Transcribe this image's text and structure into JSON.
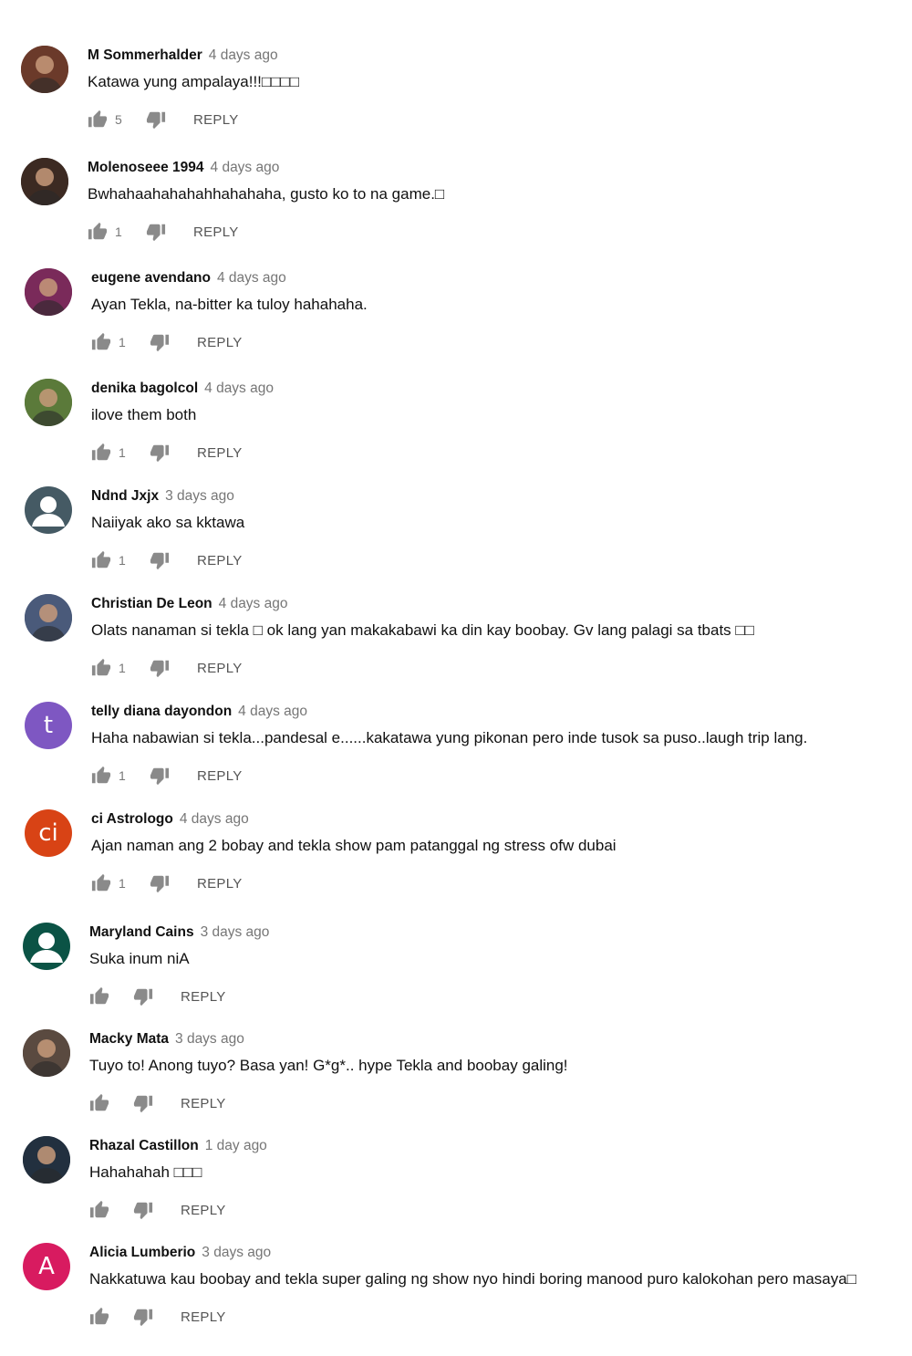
{
  "reply_label": "REPLY",
  "icons": {
    "like": "thumbs-up-icon",
    "dislike": "thumbs-down-icon"
  },
  "comments": [
    {
      "author": "M Sommerhalder",
      "time": "4 days ago",
      "text": "Katawa yung ampalaya!!!□□□□",
      "likes": "5",
      "avatar": {
        "type": "photo",
        "icon": "user-photo-avatar",
        "color": "#6b3a2a"
      }
    },
    {
      "author": "Molenoseee 1994",
      "time": "4 days ago",
      "text": "Bwhahaahahahahhahahaha, gusto ko to na game.□",
      "likes": "1",
      "avatar": {
        "type": "photo",
        "icon": "user-photo-avatar",
        "color": "#3c2a22"
      }
    },
    {
      "author": "eugene avendano",
      "time": "4 days ago",
      "text": "Ayan Tekla, na-bitter ka tuloy hahahaha.",
      "likes": "1",
      "avatar": {
        "type": "photo",
        "icon": "user-photo-avatar",
        "color": "#7a2a5a"
      }
    },
    {
      "author": "denika bagolcol",
      "time": "4 days ago",
      "text": "ilove them both",
      "likes": "1",
      "avatar": {
        "type": "photo",
        "icon": "user-photo-avatar",
        "color": "#5b7a3a"
      }
    },
    {
      "author": "Ndnd Jxjx",
      "time": "3 days ago",
      "text": "Naiiyak ako sa kktawa",
      "likes": "1",
      "avatar": {
        "type": "default",
        "icon": "default-user-avatar",
        "color": "#455a64"
      }
    },
    {
      "author": "Christian De Leon",
      "time": "4 days ago",
      "text": "Olats nanaman si tekla □ ok lang yan makakabawi ka din kay boobay. Gv lang palagi sa tbats □□",
      "likes": "1",
      "avatar": {
        "type": "photo",
        "icon": "user-photo-avatar",
        "color": "#4a5a7a"
      }
    },
    {
      "author": "telly diana dayondon",
      "time": "4 days ago",
      "text": "Haha nabawian si tekla...pandesal e......kakatawa yung pikonan pero inde tusok sa puso..laugh trip lang.",
      "likes": "1",
      "avatar": {
        "type": "letter",
        "letter": "t",
        "icon": "letter-avatar",
        "color": "#7e57c2"
      }
    },
    {
      "author": "ci Astrologo",
      "time": "4 days ago",
      "text": "Ajan naman ang 2 bobay and tekla show pam patanggal ng stress  ofw dubai",
      "likes": "1",
      "avatar": {
        "type": "letter",
        "letter": "ci",
        "icon": "letter-avatar",
        "color": "#d84315"
      }
    },
    {
      "author": "Maryland Cains",
      "time": "3 days ago",
      "text": "Suka inum niA",
      "likes": "",
      "avatar": {
        "type": "default",
        "icon": "default-user-avatar",
        "color": "#0b5345"
      }
    },
    {
      "author": "Macky Mata",
      "time": "3 days ago",
      "text": "Tuyo to! Anong tuyo? Basa yan! G*g*.. hype Tekla and boobay galing!",
      "likes": "",
      "avatar": {
        "type": "photo",
        "icon": "user-photo-avatar",
        "color": "#5a4a40"
      }
    },
    {
      "author": "Rhazal Castillon",
      "time": "1 day ago",
      "text": "Hahahahah □□□",
      "likes": "",
      "avatar": {
        "type": "photo",
        "icon": "user-photo-avatar",
        "color": "#22303f"
      }
    },
    {
      "author": "Alicia Lumberio",
      "time": "3 days ago",
      "text": "Nakkatuwa kau boobay and tekla super galing ng show nyo hindi boring manood puro kalokohan pero masaya□",
      "likes": "",
      "avatar": {
        "type": "letter",
        "letter": "A",
        "icon": "letter-avatar",
        "color": "#d81b60"
      }
    }
  ]
}
